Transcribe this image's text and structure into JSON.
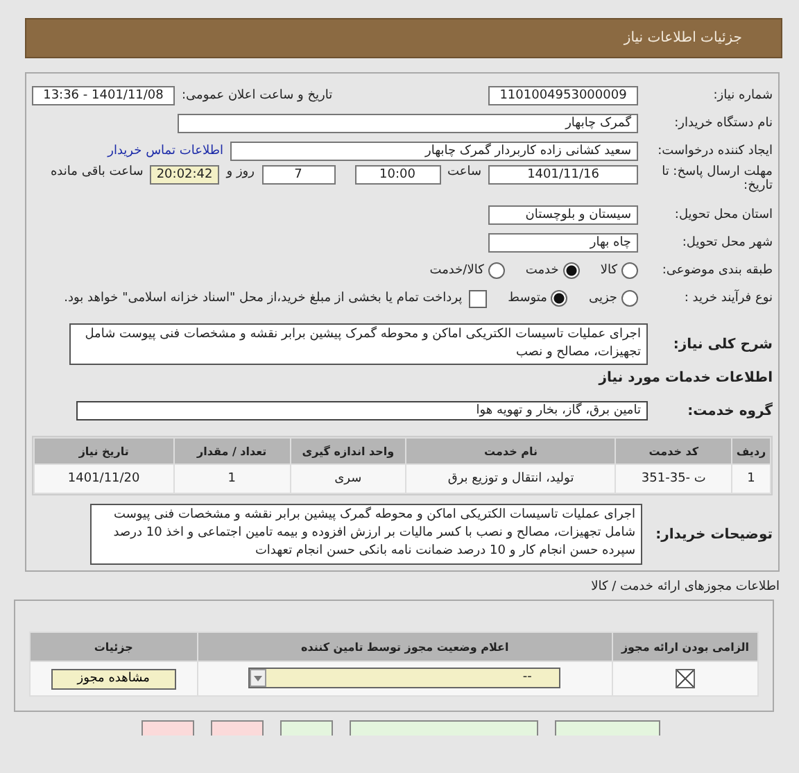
{
  "title": "جزئیات اطلاعات نیاز",
  "fields": {
    "need_number": {
      "label": "شماره نیاز:",
      "value": "1101004953000009"
    },
    "announce": {
      "label": "تاریخ و ساعت اعلان عمومی:",
      "value": "1401/11/08 - 13:36"
    },
    "buyer": {
      "label": "نام دستگاه خریدار:",
      "value": "گمرک چابهار"
    },
    "creator": {
      "label": "ایجاد کننده درخواست:",
      "value": "سعید کشانی زاده کاربردار گمرک چابهار",
      "link": "اطلاعات تماس خریدار"
    },
    "deadline": {
      "label": "مهلت ارسال پاسخ: تا تاریخ:",
      "date": "1401/11/16",
      "time_label": "ساعت",
      "time": "10:00",
      "days": "7",
      "days_label": "روز و",
      "remaining": "20:02:42",
      "remaining_label": "ساعت باقی مانده"
    },
    "province": {
      "label": "استان محل تحویل:",
      "value": "سیستان و بلوچستان"
    },
    "city": {
      "label": "شهر محل تحویل:",
      "value": "چاه بهار"
    }
  },
  "category": {
    "label": "طبقه بندی موضوعی:",
    "options": [
      {
        "label": "کالا",
        "selected": false
      },
      {
        "label": "خدمت",
        "selected": true
      },
      {
        "label": "کالا/خدمت",
        "selected": false
      }
    ]
  },
  "process": {
    "label": "نوع فرآیند خرید :",
    "options": [
      {
        "label": "جزیی",
        "selected": false
      },
      {
        "label": "متوسط",
        "selected": true
      }
    ],
    "treasury": {
      "checked": false,
      "text": "پرداخت تمام یا بخشی از مبلغ خرید،از محل \"اسناد خزانه اسلامی\" خواهد بود."
    }
  },
  "description": {
    "label": "شرح کلی نیاز:",
    "text": "اجرای عملیات تاسیسات الکتریکی اماکن و محوطه گمرک پیشین برابر نقشه و مشخصات فنی پیوست شامل تجهیزات، مصالح و نصب"
  },
  "services_heading": "اطلاعات خدمات مورد نیاز",
  "group": {
    "label": "گروه خدمت:",
    "value": "تامین برق، گاز، بخار و تهویه هوا"
  },
  "table": {
    "columns": [
      "ردیف",
      "کد خدمت",
      "نام خدمت",
      "واحد اندازه گیری",
      "تعداد / مقدار",
      "تاریخ نیاز"
    ],
    "rows": [
      [
        "1",
        "ت -35-351",
        "تولید، انتقال و توزیع برق",
        "سری",
        "1",
        "1401/11/20"
      ]
    ]
  },
  "notes": {
    "label": "توضیحات خریدار:",
    "text": "اجرای عملیات تاسیسات الکتریکی اماکن و محوطه گمرک پیشین برابر نقشه و مشخصات فنی پیوست شامل تجهیزات، مصالح و نصب با کسر مالیات بر ارزش افزوده و  بیمه تامین اجتماعی و اخذ 10 درصد سپرده حسن انجام کار و 10 درصد ضمانت نامه بانکی حسن انجام تعهدات"
  },
  "permits": {
    "heading": "اطلاعات مجوزهای ارائه خدمت / کالا",
    "columns": [
      "الزامی بودن ارائه مجوز",
      "اعلام وضعیت مجوز توسط تامین کننده",
      "جزئیات"
    ],
    "rows": [
      {
        "required": true,
        "status": "--",
        "button": "مشاهده مجوز"
      }
    ]
  },
  "bottom_buttons": [
    {
      "kind": "action"
    },
    {
      "kind": "action"
    },
    {
      "kind": "action"
    },
    {
      "kind": "cancel"
    },
    {
      "kind": "cancel"
    }
  ]
}
